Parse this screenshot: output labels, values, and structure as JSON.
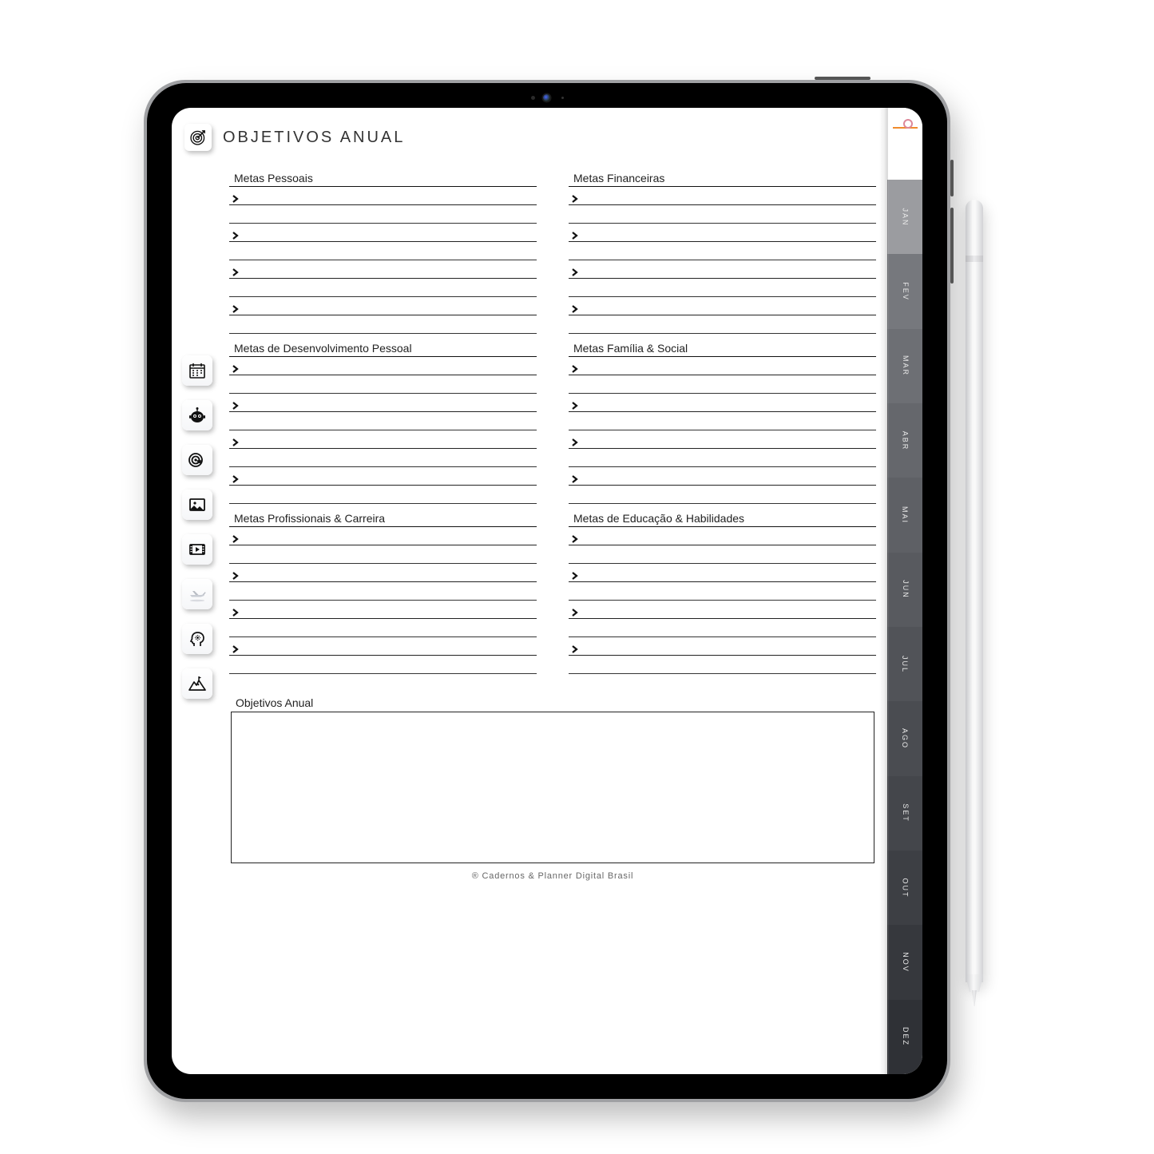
{
  "title": "OBJETIVOS ANUAL",
  "sections": {
    "left": [
      {
        "title": "Metas Pessoais"
      },
      {
        "title": "Metas de Desenvolvimento Pessoal"
      },
      {
        "title": "Metas Profissionais & Carreira"
      }
    ],
    "right": [
      {
        "title": "Metas Financeiras"
      },
      {
        "title": "Metas Família & Social"
      },
      {
        "title": "Metas de Educação & Habilidades"
      }
    ]
  },
  "objetivosBox": {
    "title": "Objetivos Anual"
  },
  "footer": "® Cadernos & Planner Digital Brasil",
  "months": [
    "JAN",
    "FEV",
    "MAR",
    "ABR",
    "MAI",
    "JUN",
    "JUL",
    "AGO",
    "SET",
    "OUT",
    "NOV",
    "DEZ"
  ],
  "monthColors": [
    "#9b9ca0",
    "#76787d",
    "#6d6f74",
    "#65676c",
    "#5e6065",
    "#585a5f",
    "#515358",
    "#4a4c51",
    "#44464b",
    "#3d3f44",
    "#36383d",
    "#2f3136"
  ],
  "sidebar": [
    {
      "name": "calendar-icon"
    },
    {
      "name": "robot-icon"
    },
    {
      "name": "target-star-icon"
    },
    {
      "name": "image-icon"
    },
    {
      "name": "video-icon"
    },
    {
      "name": "plane-icon"
    },
    {
      "name": "mind-icon"
    },
    {
      "name": "mountain-icon"
    }
  ]
}
